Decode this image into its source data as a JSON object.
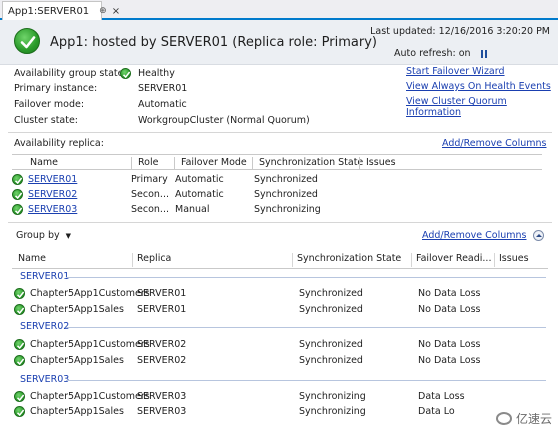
{
  "tab": {
    "label": "App1:SERVER01",
    "pin": "⊕",
    "close": "×"
  },
  "header": {
    "title": "App1: hosted by SERVER01 (Replica role: Primary)",
    "last_updated": "Last updated: 12/16/2016 3:20:20 PM",
    "auto_refresh": "Auto refresh: on"
  },
  "info": {
    "ag_state_label": "Availability group state:",
    "ag_state_value": "Healthy",
    "primary_label": "Primary instance:",
    "primary_value": "SERVER01",
    "failover_label": "Failover mode:",
    "failover_value": "Automatic",
    "cluster_label": "Cluster state:",
    "cluster_value": "WorkgroupCluster (Normal Quorum)"
  },
  "links": {
    "start_failover": "Start Failover Wizard",
    "health_events": "View Always On Health Events",
    "quorum_info": "View Cluster Quorum Information"
  },
  "replicas": {
    "title": "Availability replica:",
    "add_remove": "Add/Remove Columns",
    "columns": [
      "Name",
      "Role",
      "Failover Mode",
      "Synchronization State",
      "Issues"
    ],
    "rows": [
      {
        "name": "SERVER01",
        "role": "Primary",
        "failover": "Automatic",
        "sync": "Synchronized",
        "issues": ""
      },
      {
        "name": "SERVER02",
        "role": "Secon...",
        "failover": "Automatic",
        "sync": "Synchronized",
        "issues": ""
      },
      {
        "name": "SERVER03",
        "role": "Secon...",
        "failover": "Manual",
        "sync": "Synchronizing",
        "issues": ""
      }
    ]
  },
  "databases": {
    "group_by": "Group by",
    "add_remove": "Add/Remove Columns",
    "columns": [
      "Name",
      "Replica",
      "Synchronization State",
      "Failover Readi...",
      "Issues"
    ],
    "groups": [
      {
        "label": "SERVER01",
        "rows": [
          {
            "name": "Chapter5App1Customers",
            "replica": "SERVER01",
            "sync": "Synchronized",
            "readiness": "No Data Loss"
          },
          {
            "name": "Chapter5App1Sales",
            "replica": "SERVER01",
            "sync": "Synchronized",
            "readiness": "No Data Loss"
          }
        ]
      },
      {
        "label": "SERVER02",
        "rows": [
          {
            "name": "Chapter5App1Customers",
            "replica": "SERVER02",
            "sync": "Synchronized",
            "readiness": "No Data Loss"
          },
          {
            "name": "Chapter5App1Sales",
            "replica": "SERVER02",
            "sync": "Synchronized",
            "readiness": "No Data Loss"
          }
        ]
      },
      {
        "label": "SERVER03",
        "rows": [
          {
            "name": "Chapter5App1Customers",
            "replica": "SERVER03",
            "sync": "Synchronizing",
            "readiness": "Data Loss"
          },
          {
            "name": "Chapter5App1Sales",
            "replica": "SERVER03",
            "sync": "Synchronizing",
            "readiness": "Data Lo"
          }
        ]
      }
    ]
  },
  "watermark": "亿速云"
}
